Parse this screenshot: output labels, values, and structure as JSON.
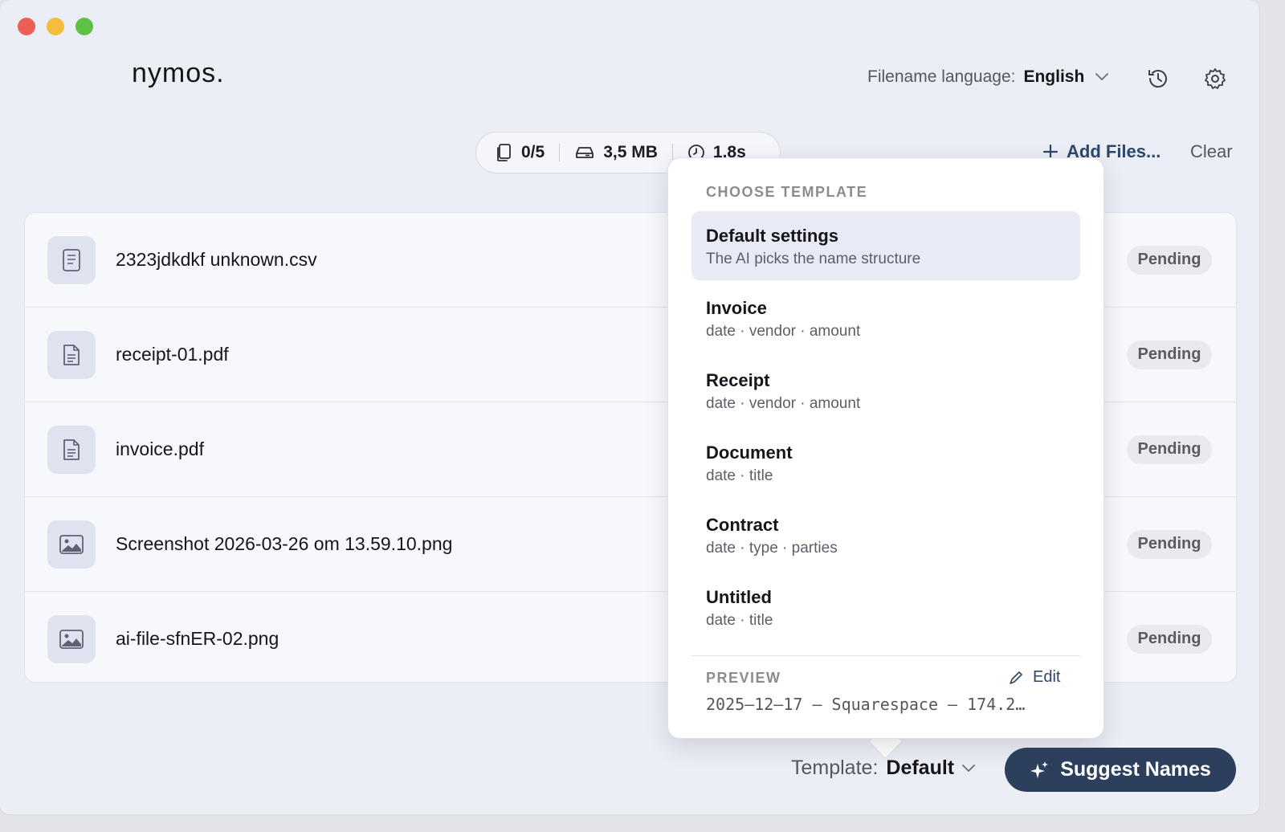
{
  "app": {
    "logo": "nymos."
  },
  "header": {
    "language_label": "Filename language:",
    "language_value": "English",
    "history_icon": "history-icon",
    "settings_icon": "gear-icon"
  },
  "stats": {
    "files": "0/5",
    "size": "3,5 MB",
    "time": "1.8s"
  },
  "toolbar": {
    "add_files_label": "Add Files...",
    "clear_label": "Clear"
  },
  "files": [
    {
      "name": "2323jdkdkf unknown.csv",
      "icon": "spreadsheet-icon",
      "status": "Pending"
    },
    {
      "name": "receipt-01.pdf",
      "icon": "document-icon",
      "status": "Pending"
    },
    {
      "name": "invoice.pdf",
      "icon": "document-icon",
      "status": "Pending"
    },
    {
      "name": "Screenshot 2026-03-26 om 13.59.10.png",
      "icon": "image-icon",
      "status": "Pending"
    },
    {
      "name": "ai-file-sfnER-02.png",
      "icon": "image-icon",
      "status": "Pending"
    }
  ],
  "template_popover": {
    "title": "CHOOSE TEMPLATE",
    "items": [
      {
        "name": "Default settings",
        "desc": "The AI picks the name structure",
        "selected": true
      },
      {
        "name": "Invoice",
        "desc": "date · vendor · amount"
      },
      {
        "name": "Receipt",
        "desc": "date · vendor · amount"
      },
      {
        "name": "Document",
        "desc": "date · title"
      },
      {
        "name": "Contract",
        "desc": "date · type · parties"
      },
      {
        "name": "Untitled",
        "desc": "date · title"
      }
    ],
    "preview_title": "PREVIEW",
    "edit_label": "Edit",
    "preview_value": "2025–12–17 – Squarespace – 174.2…"
  },
  "footer": {
    "template_label": "Template:",
    "template_value": "Default",
    "suggest_label": "Suggest Names"
  },
  "colors": {
    "accent": "#2c3f5c",
    "background": "#eceef6",
    "popover_selected": "#e8ebf5"
  }
}
